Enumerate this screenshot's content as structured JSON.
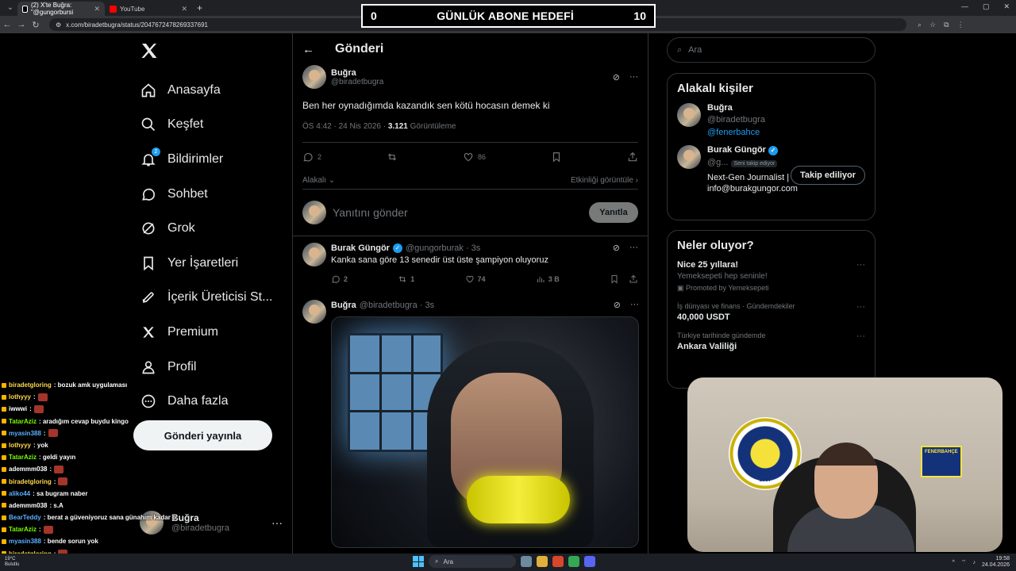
{
  "browser": {
    "tabs": [
      {
        "label": "(2) X'te Buğra: \"@gungorbursi",
        "favicon_color": "#ffffff"
      },
      {
        "label": "YouTube",
        "favicon_color": "#ff0000"
      }
    ],
    "url": "x.com/biradetbugra/status/2047672478269337691"
  },
  "goal": {
    "left": "0",
    "title": "GÜNLÜK ABONE HEDEFİ",
    "right": "10"
  },
  "nav": {
    "items": [
      {
        "label": "Anasayfa",
        "icon": "home-icon"
      },
      {
        "label": "Keşfet",
        "icon": "search-icon"
      },
      {
        "label": "Bildirimler",
        "icon": "bell-icon",
        "badge": "2"
      },
      {
        "label": "Sohbet",
        "icon": "chat-icon"
      },
      {
        "label": "Grok",
        "icon": "grok-icon"
      },
      {
        "label": "Yer İşaretleri",
        "icon": "bookmark-icon"
      },
      {
        "label": "İçerik Üreticisi St...",
        "icon": "rocket-icon"
      },
      {
        "label": "Premium",
        "icon": "x-icon"
      },
      {
        "label": "Profil",
        "icon": "profile-icon"
      },
      {
        "label": "Daha fazla",
        "icon": "more-icon"
      }
    ],
    "post_button": "Gönderi yayınla",
    "me_name": "Buğra",
    "me_handle": "@biradetbugra"
  },
  "center": {
    "title": "Gönderi",
    "post": {
      "name": "Buğra",
      "handle": "@biradetbugra",
      "text": "Ben her oynadığımda kazandık sen kötü hocasın demek ki",
      "meta": "ÖS 4:42 · 24 Nis 2026 · ",
      "views": "3.121",
      "views_label": "Görüntüleme",
      "replies": "2",
      "likes": "86",
      "relevant": "Alakalı",
      "activity": "Etkinliği görüntüle"
    },
    "reply_placeholder": "Yanıtını gönder",
    "reply_button": "Yanıtla",
    "replies": [
      {
        "name": "Burak Güngör",
        "handle": "@gungorburak · 3s",
        "text": "Kanka sana göre 13 senedir üst üste şampiyon oluyoruz",
        "replies": "2",
        "reposts": "1",
        "likes": "74",
        "views": "3 B"
      },
      {
        "name": "Buğra",
        "handle": "@biradetbugra · 3s"
      }
    ]
  },
  "right": {
    "search_placeholder": "Ara",
    "related_title": "Alakalı kişiler",
    "people": [
      {
        "name": "Buğra",
        "handle": "@biradetbugra",
        "link": "@fenerbahce"
      },
      {
        "name": "Burak Güngör",
        "handle": "@g...",
        "follows_you": "Seni takip ediyor",
        "bio": "Next-Gen Journalist | info@burakgungor.com",
        "button": "Takip ediliyor"
      }
    ],
    "trends_title": "Neler oluyor?",
    "trends": [
      {
        "meta": "",
        "title": "Nice 25 yıllara!",
        "sub": "Yemeksepeti hep seninle!",
        "promo": "Promoted by Yemeksepeti"
      },
      {
        "meta": "İş dünyası ve finans · Gündemdekiler",
        "title": "40,000 USDT"
      },
      {
        "meta": "Türkiye tarihinde gündemde",
        "title": "Ankara Valiliği"
      }
    ]
  },
  "webcam": {
    "emblem_text": "1907",
    "flag_text": "FENERBAHÇE"
  },
  "chat": [
    {
      "user": "biradetgloring",
      "color": "#ffd84a",
      "text": ": bozuk amk uygulaması",
      "emote": false
    },
    {
      "user": "lothyyy",
      "color": "#ffd84a",
      "text": ":",
      "emote": true
    },
    {
      "user": "iwwwi",
      "color": "#ffffff",
      "text": ":",
      "emote": true
    },
    {
      "user": "TatarAziz",
      "color": "#7cfc00",
      "text": ": aradığım cevap buydu kingo",
      "emote": false
    },
    {
      "user": "myasin388",
      "color": "#5ab0ff",
      "text": ":",
      "emote": true
    },
    {
      "user": "lothyyy",
      "color": "#ffd84a",
      "text": ": yok",
      "emote": false
    },
    {
      "user": "TatarAziz",
      "color": "#7cfc00",
      "text": ": geldi yayın",
      "emote": false
    },
    {
      "user": "ademmm038",
      "color": "#ffffff",
      "text": ":",
      "emote": true
    },
    {
      "user": "biradetgloring",
      "color": "#ffd84a",
      "text": ":",
      "emote": true
    },
    {
      "user": "aliko44",
      "color": "#5ab0ff",
      "text": ": sa bugram naber",
      "emote": false
    },
    {
      "user": "ademmm038",
      "color": "#ffffff",
      "text": ": s.A",
      "emote": false
    },
    {
      "user": "BearTeddy",
      "color": "#5ab0ff",
      "text": ": berat a güveniyoruz sana günahım kadar o",
      "emote": false
    },
    {
      "user": "TatarAziz",
      "color": "#7cfc00",
      "text": ":",
      "emote": true
    },
    {
      "user": "myasin388",
      "color": "#5ab0ff",
      "text": ": bende sorun yok",
      "emote": false
    },
    {
      "user": "biradetgloring",
      "color": "#ffd84a",
      "text": ":",
      "emote": true
    }
  ],
  "taskbar": {
    "weather_temp": "19°C",
    "weather_desc": "Bulutlu",
    "search": "Ara",
    "time": "19:58",
    "date": "24.04.2026"
  }
}
